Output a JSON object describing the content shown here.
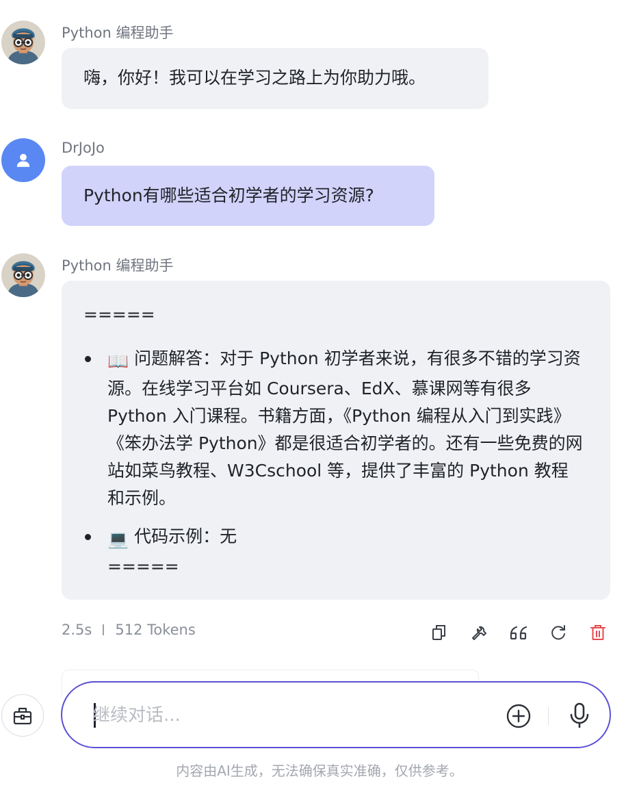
{
  "messages": [
    {
      "role": "assistant",
      "sender": "Python 编程助手",
      "text": "嗨，你好！我可以在学习之路上为你助力哦。"
    },
    {
      "role": "user",
      "sender": "DrJoJo",
      "text": "Python有哪些适合初学者的学习资源?"
    },
    {
      "role": "assistant",
      "sender": "Python 编程助手",
      "answer": {
        "separator_top": "=====",
        "items": [
          {
            "emoji": "📖",
            "text": "问题解答：对于 Python 初学者来说，有很多不错的学习资源。在线学习平台如 Coursera、EdX、慕课网等有很多 Python 入门课程。书籍方面，《Python 编程从入门到实践》《笨办法学 Python》都是很适合初学者的。还有一些免费的网站如菜鸟教程、W3Cschool 等，提供了丰富的 Python 教程和示例。"
          },
          {
            "emoji": "💻",
            "text": "代码示例：无",
            "trailer": "====="
          }
        ]
      },
      "stats": {
        "duration": "2.5s",
        "tokens": "512 Tokens"
      }
    }
  ],
  "actions": {
    "icons": [
      "copy-icon",
      "wrench-icon",
      "quote-icon",
      "refresh-icon",
      "delete-icon"
    ],
    "delete_color": "#e5484d"
  },
  "input": {
    "placeholder": "继续对话..."
  },
  "disclaimer": "内容由AI生成，无法确保真实准确，仅供参考。",
  "colors": {
    "accent": "#5a4fd6",
    "user_bubble": "#d1d3fa",
    "bot_bubble": "#f0f1f5",
    "user_avatar": "#5a88f2"
  }
}
